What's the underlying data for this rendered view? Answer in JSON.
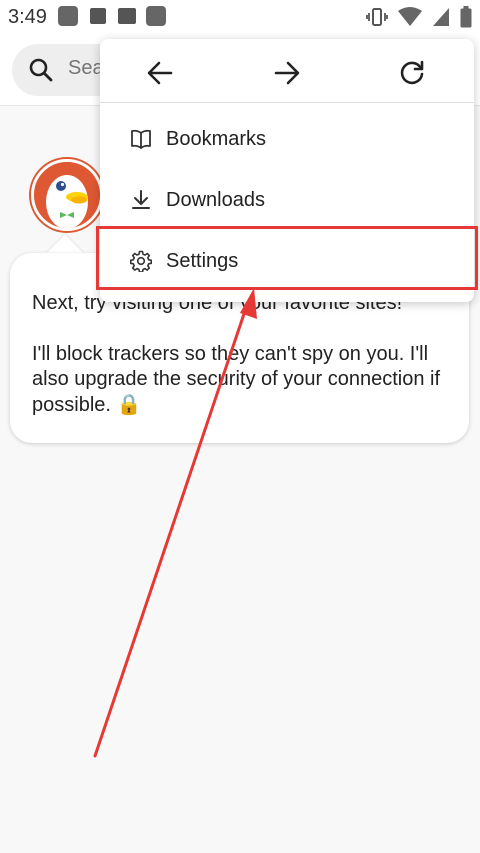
{
  "status_bar": {
    "time": "3:49"
  },
  "search": {
    "placeholder": "Sea"
  },
  "menu": {
    "items": [
      {
        "label": "Bookmarks",
        "icon": "bookmarks-icon"
      },
      {
        "label": "Downloads",
        "icon": "download-icon"
      },
      {
        "label": "Settings",
        "icon": "gear-icon"
      }
    ]
  },
  "onboarding": {
    "line1": "Next, try visiting one of your favorite sites!",
    "line2": "I'll block trackers so they can't spy on you. I'll also upgrade the security of your connection if possible. 🔒"
  },
  "colors": {
    "brand": "#de5833",
    "annotation": "#e53935"
  }
}
